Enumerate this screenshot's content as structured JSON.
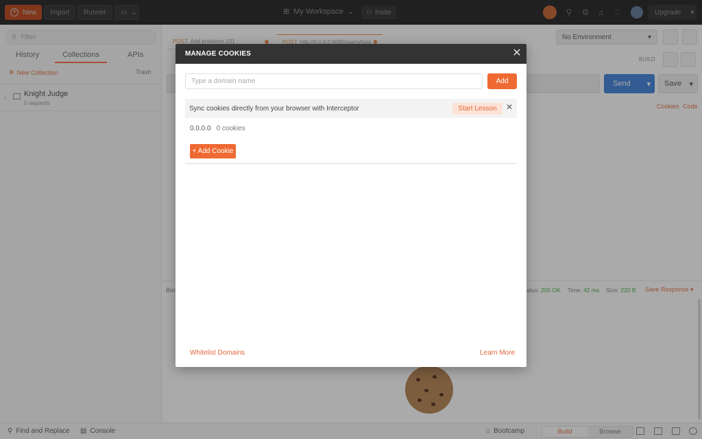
{
  "topbar": {
    "new_label": "New",
    "import_label": "Import",
    "runner_label": "Runner",
    "workspace_label": "My Workspace",
    "invite_label": "Invite",
    "upgrade_label": "Upgrade"
  },
  "sidebar": {
    "filter_placeholder": "Filter",
    "tabs": [
      "History",
      "Collections",
      "APIs"
    ],
    "active_tab": "Collections",
    "new_collection_label": "New Collection",
    "trash_label": "Trash",
    "collections": [
      {
        "name": "Knight Judge",
        "count": "5 requests"
      }
    ]
  },
  "main": {
    "tabs": [
      {
        "method": "POST",
        "label": "Add problems 101"
      },
      {
        "method": "POST",
        "label": "http://0.0.0.0:8080/users/logout"
      }
    ],
    "environment": "No Environment",
    "build_label": "BUILD",
    "send_label": "Send",
    "save_label": "Save",
    "cookies_label": "Cookies",
    "code_label": "Code",
    "response": {
      "body_label": "Boo",
      "status_label": "atus:",
      "status_value": "200 OK",
      "time_label": "Time:",
      "time_value": "42 ms",
      "size_label": "Size:",
      "size_value": "220 B",
      "save_response_label": "Save Response"
    }
  },
  "modal": {
    "title": "MANAGE COOKIES",
    "domain_placeholder": "Type a domain name",
    "add_label": "Add",
    "interceptor_text": "Sync cookies directly from your browser with Interceptor",
    "start_lesson_label": "Start Lesson",
    "domains": [
      {
        "domain": "0.0.0.0",
        "count": "0 cookies"
      }
    ],
    "add_cookie_label": "+ Add Cookie",
    "whitelist_label": "Whitelist Domains",
    "learn_more_label": "Learn More"
  },
  "statusbar": {
    "find_replace_label": "Find and Replace",
    "console_label": "Console",
    "bootcamp_label": "Bootcamp",
    "build_label": "Build",
    "browse_label": "Browse"
  },
  "colors": {
    "accent": "#ef6a32",
    "header": "#333333",
    "send": "#1f6cd1"
  }
}
